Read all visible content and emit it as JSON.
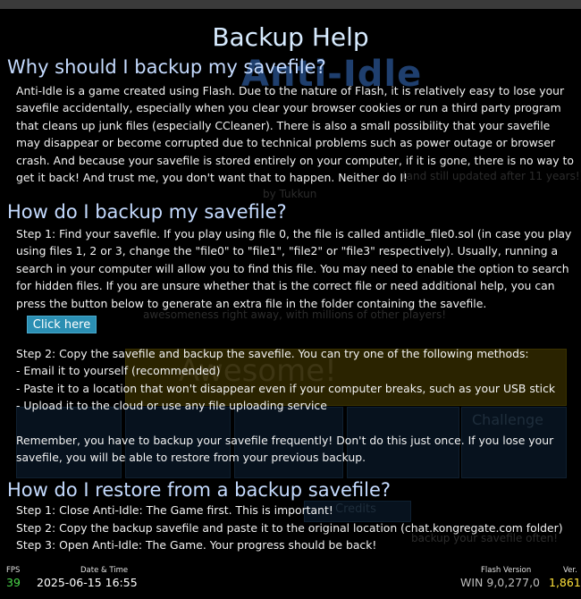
{
  "background": {
    "logo_text": "Anti-Idle",
    "byline": "by Tukkun",
    "updated_note": "(and still updated after 11 years!)",
    "tagline": "awesomeness right away, with millions of other players!",
    "awesome_label": "Awesome!",
    "challenge_label": "Challenge",
    "credits_label": "Credits",
    "backup_reminder": "backup your savefile often!"
  },
  "help": {
    "title": "Backup Help",
    "section1": {
      "heading": "Why should I backup my savefile?",
      "body": "Anti-Idle is a game created using Flash. Due to the nature of Flash, it is relatively easy to lose your savefile accidentally, especially when you clear your browser cookies or run a third party program that cleans up junk files (especially CCleaner). There is also a small possibility that your savefile may disappear or become corrupted due to technical problems such as power outage or browser crash. And because your savefile is stored entirely on your computer, if it is gone, there is no way to get it back! And trust me, you don't want that to happen. Neither do I!"
    },
    "section2": {
      "heading": "How do I backup my savefile?",
      "step1": "Step 1: Find your savefile. If you play using file 0, the file is called antiidle_file0.sol (in case you play using files 1, 2 or 3, change the \"file0\" to \"file1\", \"file2\" or \"file3\" respectively). Usually, running a search in your computer will allow you to find this file. You may need to enable the option to search for hidden files. If you are unsure whether that is the correct file or need additional help, you can press the button below to generate an extra file in the folder containing the savefile.",
      "click_here": "Click here",
      "step2": "Step 2: Copy the savefile and backup the savefile. You can try one of the following methods:",
      "methods": [
        "- Email it to yourself (recommended)",
        "- Paste it to a location that won't disappear even if your computer breaks, such as your USB stick",
        "- Upload it to the cloud or use any file uploading service"
      ],
      "reminder": "Remember, you have to backup your savefile frequently! Don't do this just once. If you lose your savefile, you will be able to restore from your previous backup."
    },
    "section3": {
      "heading": "How do I restore from a backup savefile?",
      "steps": [
        "Step 1: Close Anti-Idle: The Game first. This is important!",
        "Step 2: Copy the backup savefile and paste it to the original location (chat.kongregate.com folder)",
        "Step 3: Open Anti-Idle: The Game. Your progress should be back!"
      ]
    }
  },
  "status_bar": {
    "fps_label": "FPS",
    "fps_value": "39",
    "datetime_label": "Date & Time",
    "datetime_value": "2025-06-15 16:55",
    "flash_label": "Flash Version",
    "flash_value": "WIN 9,0,277,0",
    "ver_label": "Ver.",
    "ver_value": "1,861"
  },
  "colors": {
    "heading": "#c5dbff",
    "button": "#2b8fb3",
    "fps": "#4ad64a",
    "version": "#ffe23a"
  }
}
